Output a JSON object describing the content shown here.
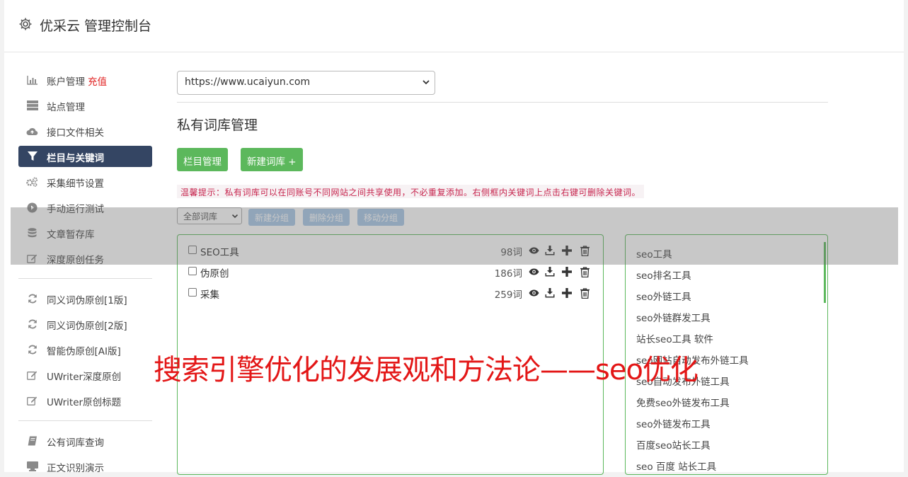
{
  "app": {
    "title": "优采云 管理控制台"
  },
  "sidebar": {
    "recharge_label": "充值",
    "items": [
      {
        "label": "账户管理",
        "icon": "bar-chart-icon"
      },
      {
        "label": "站点管理",
        "icon": "server-icon"
      },
      {
        "label": "接口文件相关",
        "icon": "cloud-upload-icon"
      },
      {
        "label": "栏目与关键词",
        "icon": "filter-icon",
        "active": true
      },
      {
        "label": "采集细节设置",
        "icon": "gears-icon"
      },
      {
        "label": "手动运行测试",
        "icon": "play-circle-icon"
      },
      {
        "label": "文章暂存库",
        "icon": "database-icon"
      },
      {
        "label": "深度原创任务",
        "icon": "edit-icon"
      },
      {
        "label": "同义词伪原创[1版]",
        "icon": "refresh-icon"
      },
      {
        "label": "同义词伪原创[2版]",
        "icon": "refresh-icon"
      },
      {
        "label": "智能伪原创[AI版]",
        "icon": "refresh-icon"
      },
      {
        "label": "UWriter深度原创",
        "icon": "edit-icon"
      },
      {
        "label": "UWriter原创标题",
        "icon": "edit-icon"
      },
      {
        "label": "公有词库查询",
        "icon": "book-icon"
      },
      {
        "label": "正文识别演示",
        "icon": "desktop-icon"
      }
    ]
  },
  "main": {
    "site_select_value": "https://www.ucaiyun.com",
    "section_title": "私有词库管理",
    "buttons": {
      "category_manage": "栏目管理",
      "new_library": "新建词库 +"
    },
    "tip": "温馨提示：私有词库可以在同账号不同网站之间共享使用，不必重复添加。右侧框内关键词上点击右键可删除关键词。",
    "group_select_value": "全部词库",
    "group_buttons": {
      "new_group": "新建分组",
      "delete_group": "删除分组",
      "move_group": "移动分组"
    },
    "libraries": [
      {
        "name": "SEO工具",
        "count": "98词"
      },
      {
        "name": "伪原创",
        "count": "186词"
      },
      {
        "name": "采集",
        "count": "259词"
      }
    ],
    "keywords": [
      "seo工具",
      "seo排名工具",
      "seo外链工具",
      "seo外链群发工具",
      "站长seo工具 软件",
      "seo网站自动发布外链工具",
      "seo自动发布外链工具",
      "免费seo外链发布工具",
      "seo外链发布工具",
      "百度seo站长工具",
      "seo 百度 站长工具"
    ]
  },
  "overlay_caption": "搜索引擎优化的发展观和方法论——seo优化"
}
